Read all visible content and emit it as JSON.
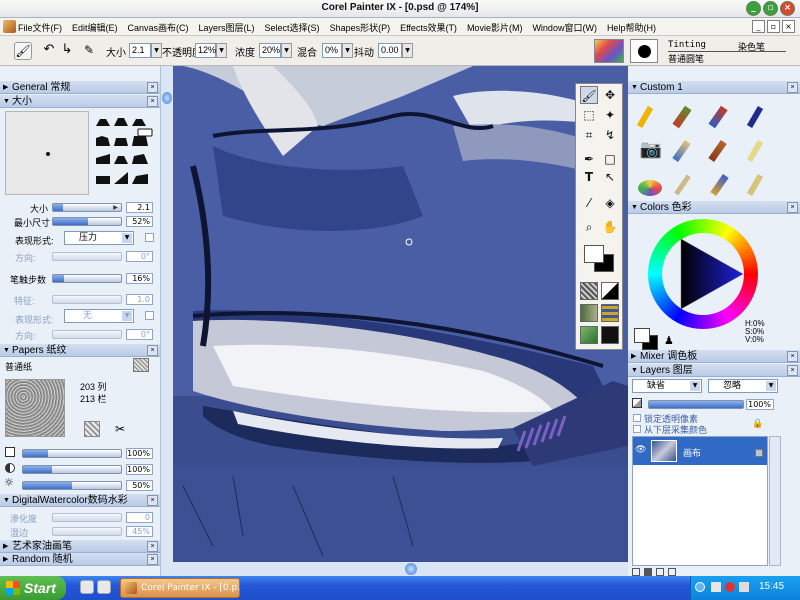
{
  "window": {
    "title": "Corel Painter IX - [0.psd @ 174%]"
  },
  "menu": [
    "File文件(F)",
    "Edit编辑(E)",
    "Canvas画布(C)",
    "Layers图层(L)",
    "Select选择(S)",
    "Shapes形状(P)",
    "Effects效果(T)",
    "Movie影片(M)",
    "Window窗口(W)",
    "Help帮助(H)"
  ],
  "propbar": {
    "size_label": "大小",
    "size_value": "2.1",
    "opacity_label": "不透明度",
    "opacity_value": "12%",
    "concentration_label": "浓度",
    "concentration_value": "20%",
    "blend_label": "混合",
    "blend_value": "0%",
    "jitter_label": "抖动",
    "jitter_value": "0.00",
    "brush_category": "Tinting",
    "brush_variant": "普通圆笔",
    "brush_category_cn": "染色笔"
  },
  "left": {
    "general": "General 常规",
    "size": "大小",
    "size_label": "大小",
    "size_value": "2.1",
    "size_pct": 0.15,
    "min_size_label": "最小尺寸",
    "min_size_value": "52%",
    "min_size_pct": 0.52,
    "expression_label": "表现形式:",
    "expression_value": "压力",
    "direction_label": "方向:",
    "direction_value": "0°",
    "spacing_label": "笔触步数",
    "spacing_value": "16%",
    "spacing_pct": 0.16,
    "feature_label": "特征:",
    "feature_value": "1.0",
    "expression2_label": "表现形式:",
    "expression2_value": "无",
    "direction2_label": "方向:",
    "direction2_value": "0°",
    "papers": "Papers 纸纹",
    "paper_name": "普通纸",
    "paper_cols": "203 列",
    "paper_rows": "213 栏",
    "scale_value": "100%",
    "scale_pct": 0.25,
    "contrast_value": "100%",
    "contrast_pct": 0.3,
    "brightness_value": "50%",
    "brightness_pct": 0.5,
    "digital_wc": "DigitalWatercolor数码水彩",
    "diffusion_label": "渗化度",
    "diffusion_value": "0",
    "wet_fringe_label": "湿边",
    "wet_fringe_value": "45%",
    "artist_oils": "艺术家油画笔",
    "random": "Random 随机"
  },
  "right": {
    "custom": "Custom 1",
    "colors": "Colors 色彩",
    "hsv": {
      "h": "H:0%",
      "s": "S:0%",
      "v": "V:0%"
    },
    "mixer": "Mixer 调色板",
    "layers": "Layers 图层",
    "composite_method": "缺省",
    "composite_depth": "忽略",
    "layer_opacity": "100%",
    "preserve_transparency": "锁定透明像素",
    "pick_up_underlying": "从下层采集颜色",
    "layer_name": "画布"
  },
  "taskbar": {
    "start": "Start",
    "task": "Corel Painter IX - [0.p...",
    "clock": "15:45"
  },
  "colors": {
    "canvas_blue": "#3b4f91",
    "panel_bg": "#eaf0f8",
    "accent_blue": "#316ac5"
  }
}
